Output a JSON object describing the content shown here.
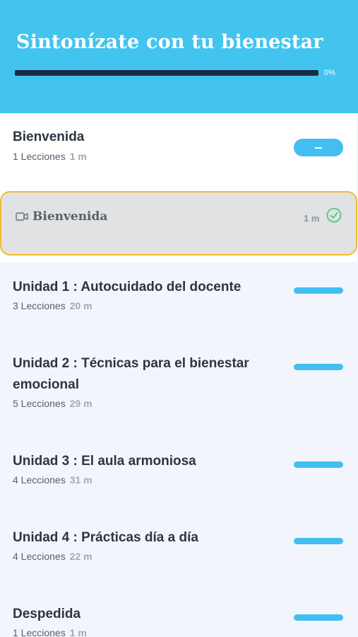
{
  "course": {
    "title": "Sintonízate con tu bienestar",
    "progress_percent": 0,
    "progress_label": "0%"
  },
  "sections": [
    {
      "title": "Bienvenida",
      "lessons_count": "1 Lecciones",
      "duration": "1 m",
      "expanded": true,
      "lessons": [
        {
          "icon": "video-icon",
          "title": "Bienvenida",
          "duration": "1 m",
          "completed": true,
          "status_icon": "check-circle-icon"
        }
      ]
    },
    {
      "title": "Unidad 1 : Autocuidado del docente",
      "lessons_count": "3 Lecciones",
      "duration": "20 m",
      "expanded": false
    },
    {
      "title": "Unidad 2 : Técnicas para el bienestar emocional",
      "lessons_count": "5 Lecciones",
      "duration": "29 m",
      "expanded": false
    },
    {
      "title": "Unidad 3 : El aula armoniosa",
      "lessons_count": "4 Lecciones",
      "duration": "31 m",
      "expanded": false
    },
    {
      "title": "Unidad 4 : Prácticas día a día",
      "lessons_count": "4 Lecciones",
      "duration": "22 m",
      "expanded": false
    },
    {
      "title": "Despedida",
      "lessons_count": "1 Lecciones",
      "duration": "1 m",
      "expanded": false
    }
  ],
  "colors": {
    "header_bg": "#42c4ef",
    "accent": "#42bff0",
    "progress_track": "#1b2b45",
    "highlight_border": "#f2bd2a",
    "completed": "#3cc46a"
  }
}
